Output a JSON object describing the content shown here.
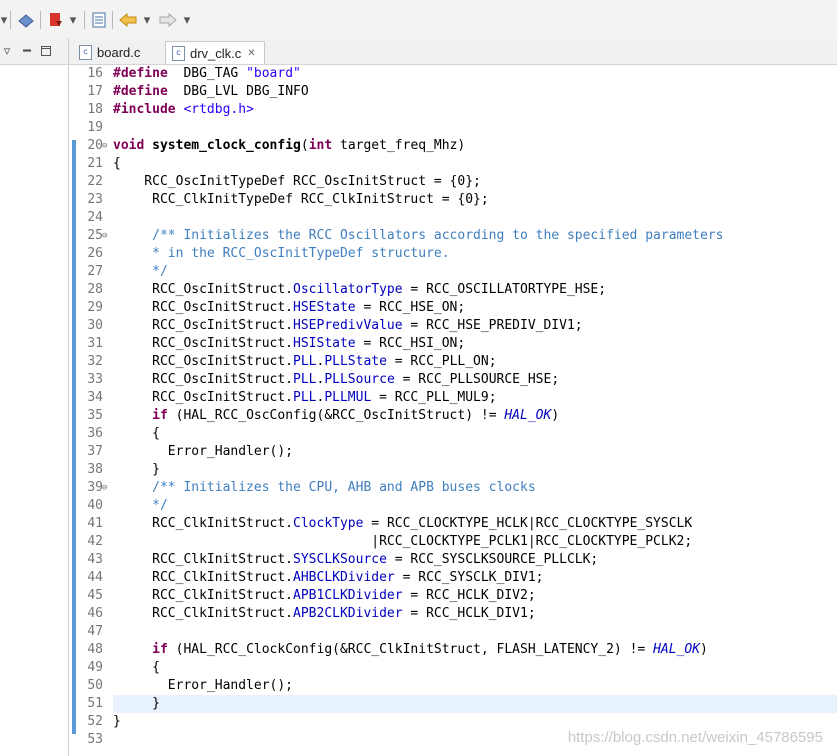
{
  "toolbar": {
    "icons": [
      "toolbar-dropdown",
      "build-icon",
      "run-icon",
      "dropdown-arrow",
      "save-icon",
      "back-arrow-icon",
      "dropdown-arrow",
      "forward-arrow-icon",
      "dropdown-arrow"
    ]
  },
  "left_pane": {
    "icons": [
      "view-menu-icon",
      "maximize-icon"
    ]
  },
  "tabs": [
    {
      "label": "board.c",
      "active": false
    },
    {
      "label": "drv_clk.c",
      "active": true,
      "close": "✕"
    }
  ],
  "editor": {
    "lines": [
      {
        "num": "16",
        "parts": [
          [
            "kw",
            "#define"
          ],
          [
            "",
            "  DBG_TAG "
          ],
          [
            "str",
            "\"board\""
          ]
        ]
      },
      {
        "num": "17",
        "parts": [
          [
            "kw",
            "#define"
          ],
          [
            "",
            "  DBG_LVL DBG_INFO"
          ]
        ]
      },
      {
        "num": "18",
        "parts": [
          [
            "kw",
            "#include"
          ],
          [
            "",
            " "
          ],
          [
            "str",
            "<rtdbg.h>"
          ]
        ]
      },
      {
        "num": "19",
        "parts": []
      },
      {
        "num": "20",
        "fold": "⊖",
        "parts": [
          [
            "kw",
            "void"
          ],
          [
            "",
            " "
          ],
          [
            "fn",
            "system_clock_config"
          ],
          [
            "",
            "("
          ],
          [
            "kw",
            "int"
          ],
          [
            "",
            " target_freq_Mhz)"
          ]
        ]
      },
      {
        "num": "21",
        "parts": [
          [
            "",
            "{"
          ]
        ]
      },
      {
        "num": "22",
        "parts": [
          [
            "",
            "    RCC_OscInitTypeDef RCC_OscInitStruct = {0};"
          ]
        ]
      },
      {
        "num": "23",
        "parts": [
          [
            "",
            "     RCC_ClkInitTypeDef RCC_ClkInitStruct = {0};"
          ]
        ]
      },
      {
        "num": "24",
        "parts": []
      },
      {
        "num": "25",
        "fold": "⊖",
        "parts": [
          [
            "cm",
            "     /** Initializes the RCC Oscillators according to the specified parameters"
          ]
        ]
      },
      {
        "num": "26",
        "parts": [
          [
            "cm",
            "     * in the RCC_OscInitTypeDef structure."
          ]
        ]
      },
      {
        "num": "27",
        "parts": [
          [
            "cm",
            "     */"
          ]
        ]
      },
      {
        "num": "28",
        "parts": [
          [
            "",
            "     RCC_OscInitStruct."
          ],
          [
            "fld",
            "OscillatorType"
          ],
          [
            "",
            " = RCC_OSCILLATORTYPE_HSE;"
          ]
        ]
      },
      {
        "num": "29",
        "parts": [
          [
            "",
            "     RCC_OscInitStruct."
          ],
          [
            "fld",
            "HSEState"
          ],
          [
            "",
            " = RCC_HSE_ON;"
          ]
        ]
      },
      {
        "num": "30",
        "parts": [
          [
            "",
            "     RCC_OscInitStruct."
          ],
          [
            "fld",
            "HSEPredivValue"
          ],
          [
            "",
            " = RCC_HSE_PREDIV_DIV1;"
          ]
        ]
      },
      {
        "num": "31",
        "parts": [
          [
            "",
            "     RCC_OscInitStruct."
          ],
          [
            "fld",
            "HSIState"
          ],
          [
            "",
            " = RCC_HSI_ON;"
          ]
        ]
      },
      {
        "num": "32",
        "parts": [
          [
            "",
            "     RCC_OscInitStruct."
          ],
          [
            "fld",
            "PLL"
          ],
          [
            "",
            "."
          ],
          [
            "fld",
            "PLLState"
          ],
          [
            "",
            " = RCC_PLL_ON;"
          ]
        ]
      },
      {
        "num": "33",
        "parts": [
          [
            "",
            "     RCC_OscInitStruct."
          ],
          [
            "fld",
            "PLL"
          ],
          [
            "",
            "."
          ],
          [
            "fld",
            "PLLSource"
          ],
          [
            "",
            " = RCC_PLLSOURCE_HSE;"
          ]
        ]
      },
      {
        "num": "34",
        "parts": [
          [
            "",
            "     RCC_OscInitStruct."
          ],
          [
            "fld",
            "PLL"
          ],
          [
            "",
            "."
          ],
          [
            "fld",
            "PLLMUL"
          ],
          [
            "",
            " = RCC_PLL_MUL9;"
          ]
        ]
      },
      {
        "num": "35",
        "parts": [
          [
            "",
            "     "
          ],
          [
            "kw",
            "if"
          ],
          [
            "",
            " (HAL_RCC_OscConfig(&RCC_OscInitStruct) != "
          ],
          [
            "con",
            "HAL_OK"
          ],
          [
            "",
            ")"
          ]
        ]
      },
      {
        "num": "36",
        "parts": [
          [
            "",
            "     {"
          ]
        ]
      },
      {
        "num": "37",
        "parts": [
          [
            "",
            "       Error_Handler();"
          ]
        ]
      },
      {
        "num": "38",
        "parts": [
          [
            "",
            "     }"
          ]
        ]
      },
      {
        "num": "39",
        "fold": "⊖",
        "parts": [
          [
            "cm",
            "     /** Initializes the CPU, AHB and APB buses clocks"
          ]
        ]
      },
      {
        "num": "40",
        "parts": [
          [
            "cm",
            "     */"
          ]
        ]
      },
      {
        "num": "41",
        "parts": [
          [
            "",
            "     RCC_ClkInitStruct."
          ],
          [
            "fld",
            "ClockType"
          ],
          [
            "",
            " = RCC_CLOCKTYPE_HCLK|RCC_CLOCKTYPE_SYSCLK"
          ]
        ]
      },
      {
        "num": "42",
        "parts": [
          [
            "",
            "                                 |RCC_CLOCKTYPE_PCLK1|RCC_CLOCKTYPE_PCLK2;"
          ]
        ]
      },
      {
        "num": "43",
        "parts": [
          [
            "",
            "     RCC_ClkInitStruct."
          ],
          [
            "fld",
            "SYSCLKSource"
          ],
          [
            "",
            " = RCC_SYSCLKSOURCE_PLLCLK;"
          ]
        ]
      },
      {
        "num": "44",
        "parts": [
          [
            "",
            "     RCC_ClkInitStruct."
          ],
          [
            "fld",
            "AHBCLKDivider"
          ],
          [
            "",
            " = RCC_SYSCLK_DIV1;"
          ]
        ]
      },
      {
        "num": "45",
        "parts": [
          [
            "",
            "     RCC_ClkInitStruct."
          ],
          [
            "fld",
            "APB1CLKDivider"
          ],
          [
            "",
            " = RCC_HCLK_DIV2;"
          ]
        ]
      },
      {
        "num": "46",
        "parts": [
          [
            "",
            "     RCC_ClkInitStruct."
          ],
          [
            "fld",
            "APB2CLKDivider"
          ],
          [
            "",
            " = RCC_HCLK_DIV1;"
          ]
        ]
      },
      {
        "num": "47",
        "parts": []
      },
      {
        "num": "48",
        "parts": [
          [
            "",
            "     "
          ],
          [
            "kw",
            "if"
          ],
          [
            "",
            " (HAL_RCC_ClockConfig(&RCC_ClkInitStruct, FLASH_LATENCY_2) != "
          ],
          [
            "con",
            "HAL_OK"
          ],
          [
            "",
            ")"
          ]
        ]
      },
      {
        "num": "49",
        "parts": [
          [
            "",
            "     {"
          ]
        ]
      },
      {
        "num": "50",
        "parts": [
          [
            "",
            "       Error_Handler();"
          ]
        ]
      },
      {
        "num": "51",
        "current": true,
        "parts": [
          [
            "",
            "     }"
          ]
        ]
      },
      {
        "num": "52",
        "parts": [
          [
            "",
            "}"
          ]
        ]
      },
      {
        "num": "53",
        "parts": []
      }
    ]
  },
  "watermark": "https://blog.csdn.net/weixin_45786595"
}
